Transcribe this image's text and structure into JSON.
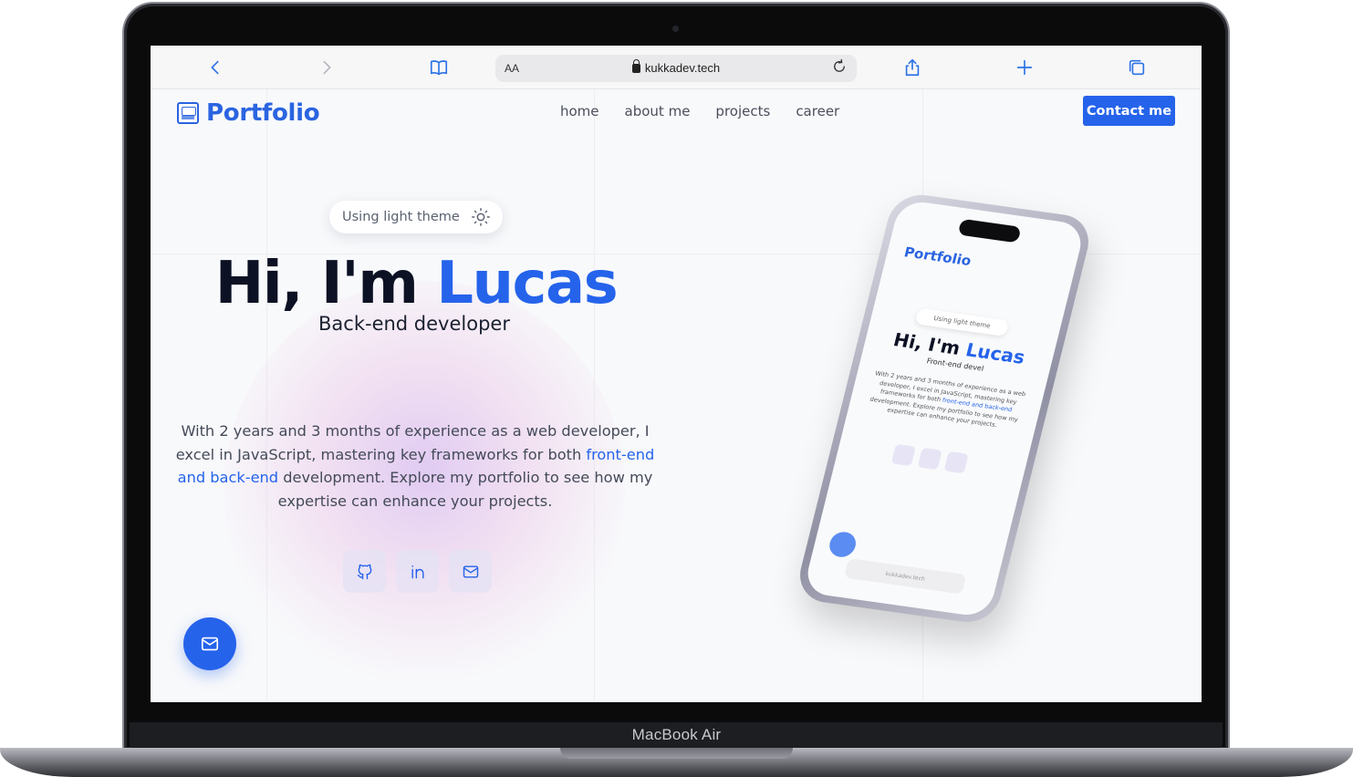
{
  "device": {
    "model_label": "MacBook Air"
  },
  "browser": {
    "url": "kukkadev.tech",
    "text_size_label": "AA",
    "icons": [
      "back-chevron-icon",
      "forward-chevron-icon",
      "bookmarks-icon",
      "lock-icon",
      "reload-icon",
      "share-icon",
      "new-tab-icon",
      "tabs-icon"
    ]
  },
  "site": {
    "logo_text": "Portfolio",
    "nav": [
      {
        "label": "home"
      },
      {
        "label": "about me"
      },
      {
        "label": "projects"
      },
      {
        "label": "career"
      }
    ],
    "contact_label": "Contact me",
    "theme_toggle_label": "Using light theme",
    "hero": {
      "greeting": "Hi, I'm",
      "name": "Lucas",
      "role": "Back-end developer"
    },
    "bio": {
      "part1": "With 2 years and 3 months of experience as a web developer, I excel in JavaScript, mastering key frameworks for both ",
      "link": "front-end and back-end",
      "part2": " development. Explore my portfolio to see how my expertise can enhance your projects."
    },
    "socials": [
      {
        "icon": "github-icon"
      },
      {
        "icon": "linkedin-icon"
      },
      {
        "icon": "mail-icon"
      }
    ],
    "fab_icon": "mail-icon"
  },
  "phone_mockup": {
    "logo_text": "Portfolio",
    "theme_label": "Using light theme",
    "greeting": "Hi, I'm",
    "name": "Lucas",
    "role": "Front-end devel",
    "bio_part1": "With 2 years and 3 months of experience as a web developer, I excel in JavaScript, mastering key frameworks for both ",
    "bio_link": "front-end and back-end",
    "bio_part2": " development. Explore my portfolio to see how my expertise can enhance your projects.",
    "url": "kukkadev.tech"
  },
  "colors": {
    "accent": "#2563eb",
    "heading": "#0c1124",
    "page_bg": "#f8f9fb"
  }
}
